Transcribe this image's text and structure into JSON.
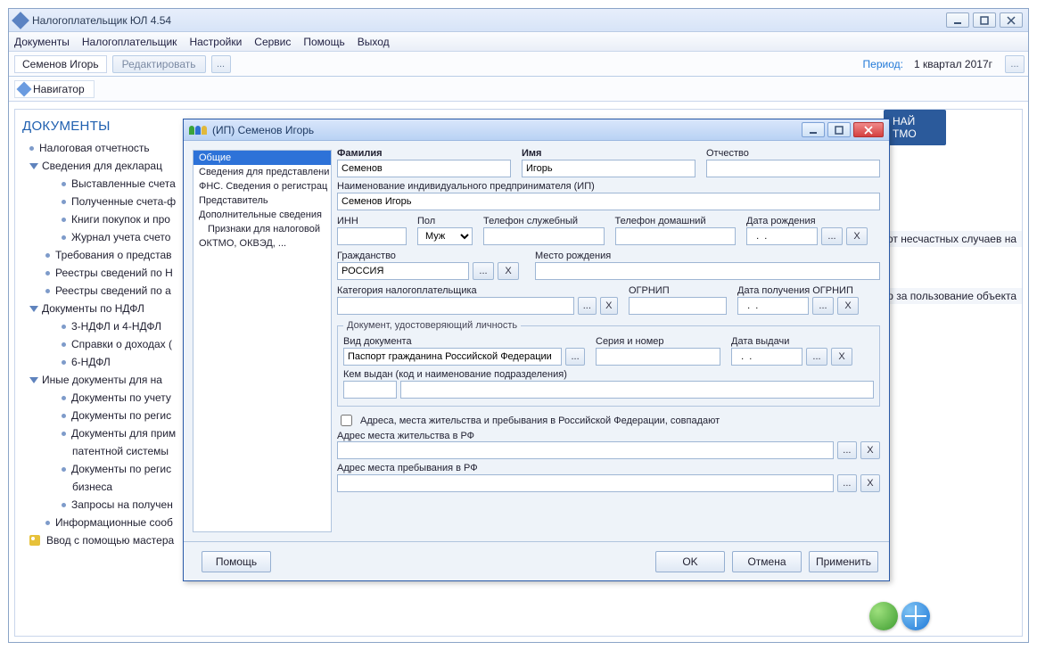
{
  "main": {
    "title": "Налогоплательщик ЮЛ 4.54",
    "menu": [
      "Документы",
      "Налогоплательщик",
      "Настройки",
      "Сервис",
      "Помощь",
      "Выход"
    ],
    "user": "Семенов Игорь",
    "edit_btn": "Редактировать",
    "dots_btn": "...",
    "period_label": "Период:",
    "period_value": "1 квартал 2017г",
    "navigator": "Навигатор"
  },
  "doc_panel": {
    "heading": "ДОКУМЕНТЫ",
    "items": {
      "n1": "Налоговая отчетность",
      "n2": "Сведения для декларац",
      "n2a": "Выставленные счета",
      "n2b": "Полученные счета-ф",
      "n2c": "Книги покупок и про",
      "n2d": "Журнал учета счето",
      "n3": "Требования о представ",
      "n4": "Реестры сведений по Н",
      "n5": "Реестры сведений по а",
      "n6": "Документы по НДФЛ",
      "n6a": "3-НДФЛ и 4-НДФЛ",
      "n6b": "Справки о доходах (",
      "n6c": "6-НДФЛ",
      "n7": "Иные документы для на",
      "n7a": "Документы по учету",
      "n7b": "Документы по регис",
      "n7c": "Документы для прим",
      "n7c2": "патентной системы",
      "n7d": "Документы по регис",
      "n7d2": "бизнеса",
      "n7e": "Запросы на получен",
      "n8": "Информационные сооб",
      "n9": "Ввод с помощью мастера"
    }
  },
  "side_text": {
    "blue1a": "НАЙ",
    "blue1b": "ТМО",
    "gray1": "ние от несчастных случаев на",
    "gray2": "Сбор за пользование объекта"
  },
  "dialog": {
    "title": "(ИП) Семенов Игорь",
    "left_tabs": [
      "Общие",
      "Сведения для представлени",
      "ФНС. Сведения о регистрац",
      "Представитель",
      "Дополнительные сведения",
      "Признаки для налоговой",
      "ОКТМО, ОКВЭД, ..."
    ],
    "labels": {
      "fam": "Фамилия",
      "name": "Имя",
      "otch": "Отчество",
      "ip_name": "Наименование индивидуального предпринимателя (ИП)",
      "inn": "ИНН",
      "pol": "Пол",
      "tel_s": "Телефон служебный",
      "tel_d": "Телефон домашний",
      "dob": "Дата рождения",
      "cit": "Гражданство",
      "birthplace": "Место рождения",
      "cat": "Категория налогоплательщика",
      "ogrnip": "ОГРНИП",
      "ogrnip_date": "Дата получения ОГРНИП",
      "doc_group": "Документ, удостоверяющий личность",
      "doc_type": "Вид документа",
      "doc_sn": "Серия и номер",
      "doc_date": "Дата выдачи",
      "doc_issuer": "Кем выдан (код и наименование подразделения)",
      "addr_same": "Адреса, места жительства и пребывания в Российской Федерации, совпадают",
      "addr_live": "Адрес места жительства в РФ",
      "addr_stay": "Адрес места пребывания в РФ"
    },
    "values": {
      "fam": "Семенов",
      "name": "Игорь",
      "otch": "",
      "ip_name": "Семенов Игорь",
      "inn": "",
      "pol": "Муж",
      "tel_s": "",
      "tel_d": "",
      "dob": "  .  .",
      "cit": "РОССИЯ",
      "birthplace": "",
      "cat": "",
      "ogrnip": "",
      "ogrnip_date": "  .  .",
      "doc_type": "Паспорт гражданина Российской Федерации",
      "doc_sn": "",
      "doc_date": "  .  .",
      "doc_code": "",
      "doc_issuer_text": "",
      "addr_live": "",
      "addr_stay": ""
    },
    "buttons": {
      "help": "Помощь",
      "ok": "OK",
      "cancel": "Отмена",
      "apply": "Применить",
      "ellipsis": "...",
      "x": "X"
    }
  }
}
